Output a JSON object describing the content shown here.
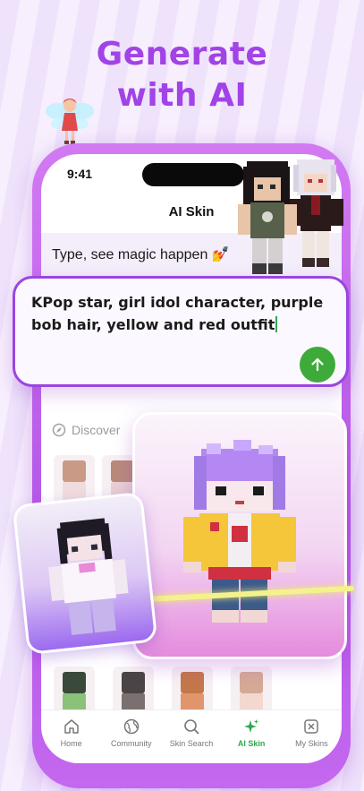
{
  "promo": {
    "headline_line1": "Generate",
    "headline_line2": "with AI"
  },
  "status_bar": {
    "time": "9:41"
  },
  "nav": {
    "title": "AI Skin"
  },
  "prompt_bar": {
    "placeholder_text": "Type, see magic happen",
    "emoji": "💅"
  },
  "input": {
    "value": "KPop star, girl idol character, purple bob hair, yellow and red outfit",
    "send_icon": "arrow-up-icon"
  },
  "discover": {
    "label": "Discover",
    "icon": "compass-icon"
  },
  "tabs": [
    {
      "label": "Home",
      "icon": "home-icon",
      "active": false
    },
    {
      "label": "Community",
      "icon": "globe-icon",
      "active": false
    },
    {
      "label": "Skin Search",
      "icon": "search-icon",
      "active": false
    },
    {
      "label": "AI Skin",
      "icon": "sparkles-icon",
      "active": true
    },
    {
      "label": "My Skins",
      "icon": "skins-icon",
      "active": false
    }
  ],
  "colors": {
    "accent_purple": "#a143e6",
    "send_green": "#3eaa3a",
    "active_tab_green": "#2fa84f"
  }
}
